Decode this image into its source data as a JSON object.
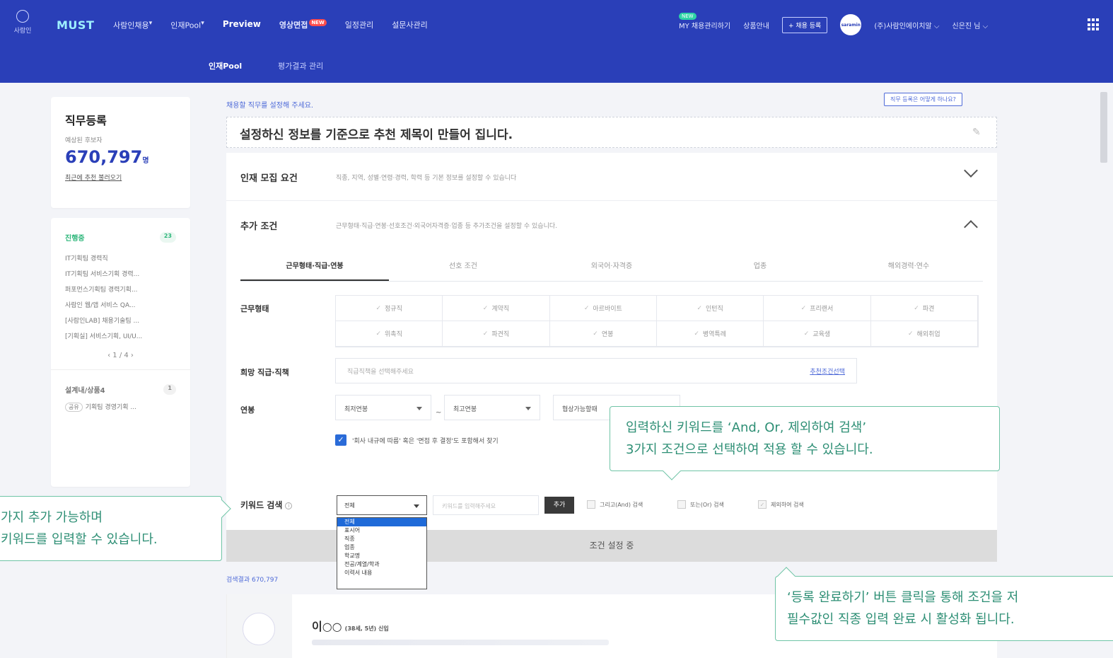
{
  "topbar": {
    "home_label": "사람인",
    "brand": "MUST",
    "nav": [
      {
        "label": "사람인채용",
        "bold": false,
        "new": false
      },
      {
        "label": "인재Pool",
        "bold": false,
        "new": false
      },
      {
        "label": "Preview",
        "bold": true,
        "new": false
      },
      {
        "label": "영상면접",
        "bold": true,
        "new": true
      },
      {
        "label": "일정관리",
        "bold": false,
        "new": false
      },
      {
        "label": "설문사관리",
        "bold": false,
        "new": false
      }
    ],
    "new_badge": "NEW",
    "my_label": "MY 채용관리하기",
    "my_badge": "NEW",
    "help_label": "상품안내",
    "post_button": "+ 채용 등록",
    "avatar_text": "saramin",
    "company": "(주)사람인에이치알 ⌵",
    "user": "신은진 님 ⌵"
  },
  "subnav": {
    "items": [
      "인재Pool",
      "평가결과 관리"
    ]
  },
  "sidebar": {
    "title": "직무등록",
    "sub": "예상된 후보자",
    "count": "670,797",
    "count_unit": "명",
    "link": "최근에 추천 불러오기",
    "list_header": "진행중",
    "list_count": "23",
    "items": [
      "IT기획팀 경력직",
      "IT기획팀 서비스기획 경력...",
      "퍼포먼스기획팀 경력기획...",
      "사람인 웹/앱 서비스 QA...",
      "[사람인LAB] 채용기술팀 ...",
      "[기획실] 서비스기획, UI/U..."
    ],
    "pager": "‹  1 / 4  ›",
    "section2": "설계내/상품4",
    "section2_count": "1",
    "section2_item_tag": "공유",
    "section2_item": "기획팀 경영기획 ..."
  },
  "main": {
    "hint": "채용할 직무를 설정해 주세요.",
    "helper_button": "직무 등록은 어떻게 하나요?",
    "title": "설정하신 정보를 기준으로 추천 제목이 만들어 집니다.",
    "sections": [
      {
        "label": "인재 모집 요건",
        "desc": "직종, 지역, 성별·연령·경력, 학력 등 기본 정보를 설정할 수 있습니다"
      },
      {
        "label": "추가 조건",
        "desc": "근무형태·직급·연봉·선호조건·외국어자격증·업종 등 추가조건을 설정할 수 있습니다."
      }
    ],
    "tabs": [
      "근무형태·직급·연봉",
      "선호 조건",
      "외국어·자격증",
      "업종",
      "해외경력·연수"
    ],
    "work_type_label": "근무형태",
    "work_types": [
      "정규직",
      "계약직",
      "아르바이트",
      "인턴직",
      "프리랜서",
      "파견",
      "위촉직",
      "파견직",
      "연봉",
      "병역특례",
      "교육생",
      "해외취업"
    ],
    "rank_label": "희망 직급·직책",
    "rank_placeholder": "직급직책을 선택해주세요",
    "rank_link": "추천조건선택",
    "salary_label": "연봉",
    "salary_min": "최저연봉",
    "salary_max": "최고연봉",
    "salary_dash": "~",
    "salary_extra": "협상가능할때",
    "agree_text": "'회사 내규에 따름' 혹은 '면접 후 결정'도 포함해서 찾기",
    "keyword_label": "키워드 검색",
    "keyword_select": "전체",
    "keyword_placeholder": "키워드를 입력해주세요",
    "keyword_add": "추가",
    "keyword_opts": [
      "그리고(And) 검색",
      "또는(Or) 검색",
      "제외하여 검색"
    ],
    "dropdown_options": [
      "전체",
      "표시어",
      "직종",
      "업종",
      "학교명",
      "전공/계열/학과",
      "이력서 내용"
    ],
    "cond_bar": "조건 설정 중",
    "result_label": "검색결과 670,797",
    "result_name": "이○○",
    "result_meta": "(38세, 5년) 신입"
  },
  "callouts": {
    "left_line1": "가지 추가 가능하며",
    "left_line2": "키워드를 입력할 수 있습니다.",
    "mid_line1": "입력하신 키워드를 ‘And, Or, 제외하여 검색’",
    "mid_line2": "3가지 조건으로 선택하여 적용 할 수 있습니다.",
    "right_line1": "‘등록 완료하기’ 버튼 클릭을 통해 조건을 저",
    "right_line2": "필수값인 직종 입력 완료 시 활성화 됩니다."
  },
  "colors": {
    "nav_bg": "#2a3fb8",
    "accent": "#4e6ad8",
    "callout": "#6fc4a6"
  }
}
